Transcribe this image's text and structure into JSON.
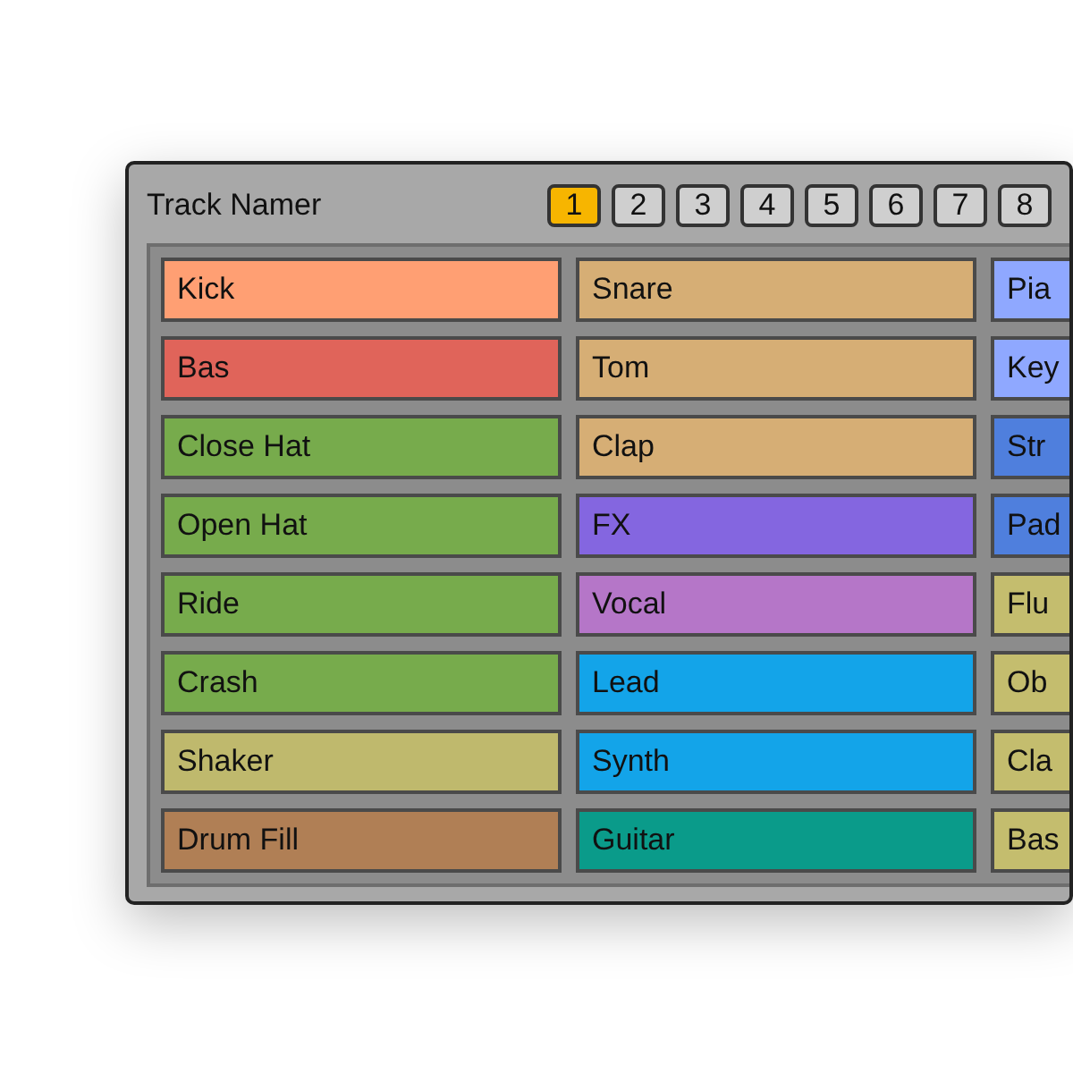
{
  "window": {
    "title": "Track Namer"
  },
  "pages": [
    {
      "label": "1",
      "selected": true
    },
    {
      "label": "2",
      "selected": false
    },
    {
      "label": "3",
      "selected": false
    },
    {
      "label": "4",
      "selected": false
    },
    {
      "label": "5",
      "selected": false
    },
    {
      "label": "6",
      "selected": false
    },
    {
      "label": "7",
      "selected": false
    },
    {
      "label": "8",
      "selected": false
    }
  ],
  "columns": [
    [
      {
        "name": "Kick",
        "color": "#ff9f73"
      },
      {
        "name": "Bas",
        "color": "#e0645a"
      },
      {
        "name": "Close Hat",
        "color": "#77ab4c"
      },
      {
        "name": "Open Hat",
        "color": "#77ab4c"
      },
      {
        "name": "Ride",
        "color": "#77ab4c"
      },
      {
        "name": "Crash",
        "color": "#77ab4c"
      },
      {
        "name": "Shaker",
        "color": "#bfb96d"
      },
      {
        "name": "Drum Fill",
        "color": "#b07f55"
      }
    ],
    [
      {
        "name": "Snare",
        "color": "#d6ae75"
      },
      {
        "name": "Tom",
        "color": "#d6ae75"
      },
      {
        "name": "Clap",
        "color": "#d6ae75"
      },
      {
        "name": "FX",
        "color": "#8466e0"
      },
      {
        "name": "Vocal",
        "color": "#b576c8"
      },
      {
        "name": "Lead",
        "color": "#13a4e9"
      },
      {
        "name": "Synth",
        "color": "#13a4e9"
      },
      {
        "name": "Guitar",
        "color": "#0a9b8a"
      }
    ],
    [
      {
        "name": "Pia",
        "color": "#8fa8ff"
      },
      {
        "name": "Key",
        "color": "#8fa8ff"
      },
      {
        "name": "Str",
        "color": "#4f7fdd"
      },
      {
        "name": "Pad",
        "color": "#4f7fdd"
      },
      {
        "name": "Flu",
        "color": "#c4bd6e"
      },
      {
        "name": "Ob",
        "color": "#c4bd6e"
      },
      {
        "name": "Cla",
        "color": "#c4bd6e"
      },
      {
        "name": "Bas",
        "color": "#c4bd6e"
      }
    ]
  ]
}
